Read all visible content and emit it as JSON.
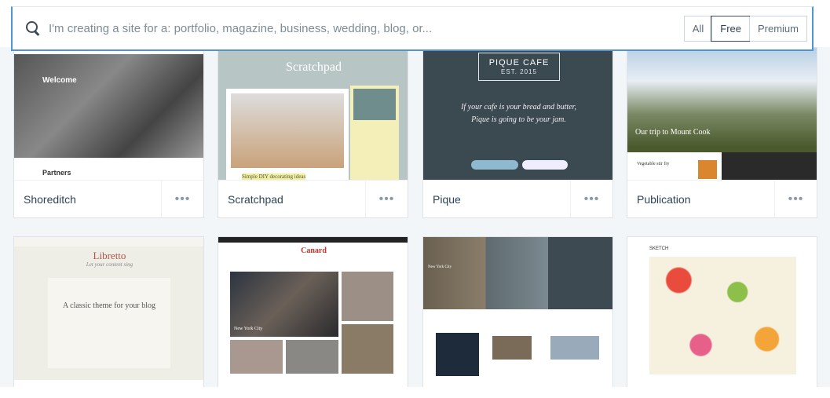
{
  "search": {
    "placeholder": "I'm creating a site for a: portfolio, magazine, business, wedding, blog, or...",
    "icon": "search-icon"
  },
  "filters": [
    {
      "label": "All",
      "selected": false
    },
    {
      "label": "Free",
      "selected": true
    },
    {
      "label": "Premium",
      "selected": false
    }
  ],
  "themes": [
    {
      "name": "Shoreditch",
      "preview": {
        "heading": "Welcome",
        "sub": "Partners"
      }
    },
    {
      "name": "Scratchpad",
      "preview": {
        "heading": "Scratchpad",
        "sub": "Simple DIY decorating ideas"
      }
    },
    {
      "name": "Pique",
      "preview": {
        "heading": "PIQUE CAFE",
        "est": "EST. 2015",
        "line1": "If your cafe is your bread and butter,",
        "line2": "Pique is going to be your jam."
      }
    },
    {
      "name": "Publication",
      "preview": {
        "heading": "Our trip to Mount Cook",
        "sub": "Vegetable stir fry"
      }
    },
    {
      "preview": {
        "heading": "Libretto",
        "tagline": "Let your content sing",
        "sub": "A classic theme for your blog"
      }
    },
    {
      "preview": {
        "heading": "Canard",
        "sub": "New York City"
      }
    },
    {
      "preview": {
        "heading": "",
        "sub": "New York City"
      }
    },
    {
      "preview": {
        "heading": "SKETCH"
      }
    }
  ],
  "more_label": "•••",
  "colors": {
    "accent": "#4f94d4",
    "background": "#f3f6f8"
  }
}
